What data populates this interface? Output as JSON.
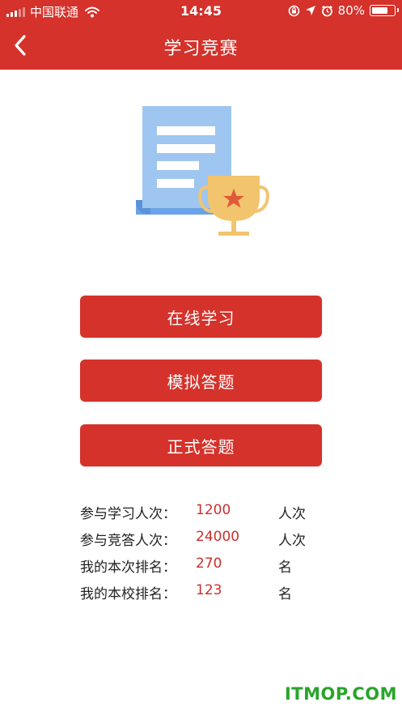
{
  "statusbar": {
    "carrier": "中国联通",
    "time": "14:45",
    "battery_pct": "80%",
    "battery_level": 0.8,
    "icons": [
      "signal-icon",
      "wifi-icon",
      "rotation-lock-icon",
      "location-icon",
      "alarm-icon",
      "battery-icon"
    ]
  },
  "header": {
    "title": "学习竞赛",
    "back_icon": "chevron-left-icon"
  },
  "colors": {
    "primary": "#d4322b",
    "value_red": "#c9302c",
    "doc_blue": "#9fc6f0",
    "trophy_gold": "#f3c46e",
    "watermark_green": "#27a52a"
  },
  "buttons": {
    "online_study": "在线学习",
    "mock_quiz": "模拟答题",
    "formal_quiz": "正式答题"
  },
  "stats": [
    {
      "label": "参与学习人次：",
      "value": "1200",
      "unit": "人次"
    },
    {
      "label": "参与竞答人次：",
      "value": "24000",
      "unit": "人次"
    },
    {
      "label": "我的本次排名：",
      "value": "270",
      "unit": "名"
    },
    {
      "label": "我的本校排名：",
      "value": "123",
      "unit": "名"
    }
  ],
  "watermark": "ITMOP.COM"
}
